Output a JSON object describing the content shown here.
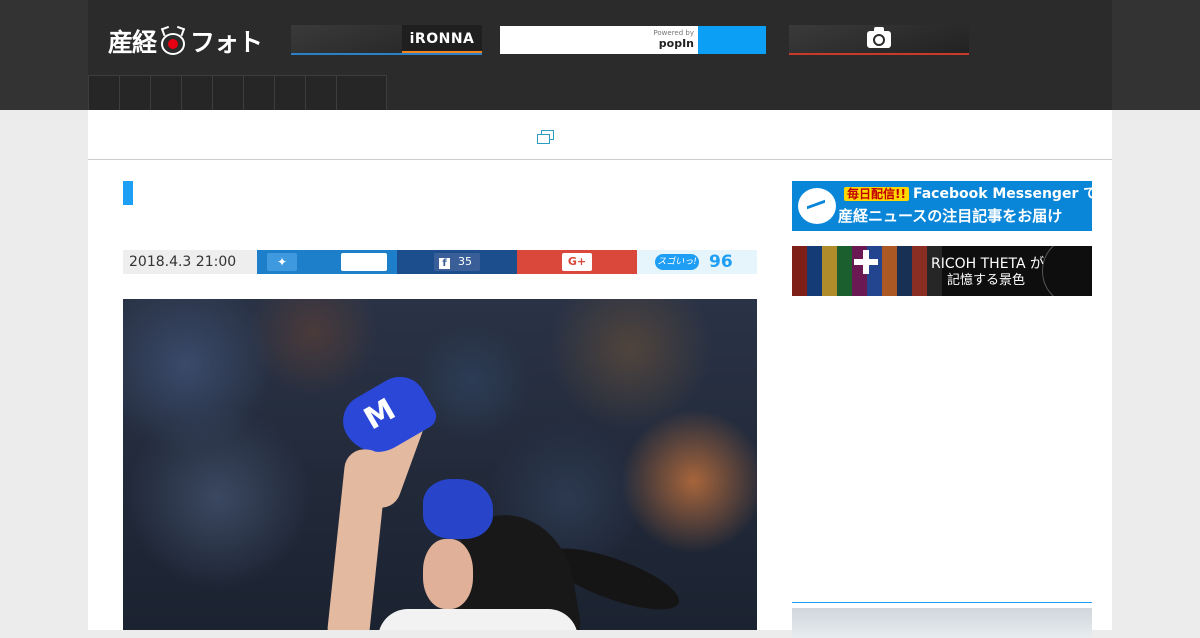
{
  "header": {
    "logo_left": "産経",
    "logo_right": "フォト",
    "ironna_label": "iRONNA",
    "search": {
      "placeholder": "",
      "powered_by": "Powered by",
      "provider": "popIn"
    },
    "nav_item_count": 9
  },
  "article": {
    "date": "2018.4.3 21:00",
    "facebook_count": "35",
    "googleplus_label": "G+",
    "sugoi_label": "スゴいっ!",
    "sugoi_count": "96"
  },
  "sidebar": {
    "messenger_banner": {
      "tag": "毎日配信!!",
      "headline": "Facebook Messenger で",
      "subline": "産経ニュースの注目記事をお届け"
    },
    "theta_banner": {
      "line1": "RICOH THETA が",
      "line2": "記憶する景色"
    }
  },
  "colors": {
    "header_bg": "#2b2b2b",
    "accent_blue": "#1e9ef4",
    "twitter": "#1d7fca",
    "facebook": "#1c4d8c",
    "googleplus": "#d9483b"
  }
}
